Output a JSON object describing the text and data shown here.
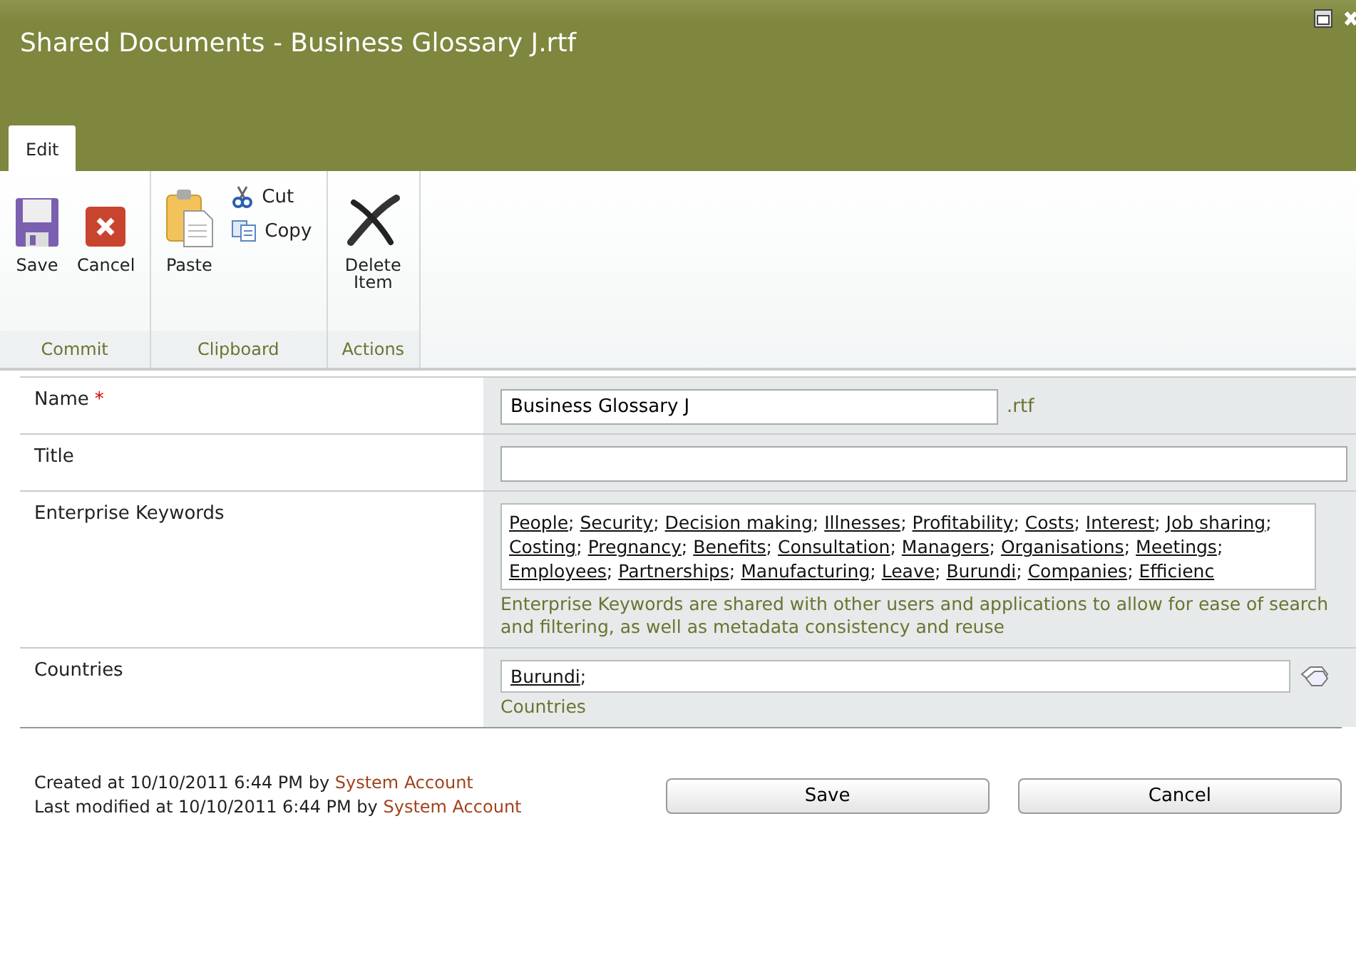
{
  "window": {
    "title": "Shared Documents - Business Glossary J.rtf"
  },
  "tabs": [
    {
      "label": "Edit",
      "selected": true
    }
  ],
  "ribbon": {
    "groups": [
      {
        "label": "Commit",
        "buttons": [
          {
            "kind": "save",
            "label": "Save"
          },
          {
            "kind": "cancel",
            "label": "Cancel"
          }
        ]
      },
      {
        "label": "Clipboard",
        "buttons": [
          {
            "kind": "paste",
            "label": "Paste"
          },
          {
            "kind": "cut",
            "label": "Cut"
          },
          {
            "kind": "copy",
            "label": "Copy"
          }
        ]
      },
      {
        "label": "Actions",
        "buttons": [
          {
            "kind": "delete",
            "label": "Delete Item"
          }
        ]
      }
    ]
  },
  "form": {
    "required_mark": "*",
    "term_separator": ";",
    "fields": [
      {
        "kind": "text",
        "label": "Name",
        "required": true,
        "value": "Business Glossary J",
        "suffix": ".rtf"
      },
      {
        "kind": "text",
        "label": "Title",
        "required": false
      },
      {
        "kind": "keywords",
        "label": "Enterprise Keywords",
        "required": false,
        "terms": [
          "People",
          "Security",
          "Decision making",
          "Illnesses",
          "Profitability",
          "Costs",
          "Interest",
          "Job sharing",
          "Costing",
          "Pregnancy",
          "Benefits",
          "Consultation",
          "Managers",
          "Organisations",
          "Meetings",
          "Employees",
          "Partnerships",
          "Manufacturing",
          "Leave",
          "Burundi",
          "Companies",
          "Efficienc"
        ],
        "hint": "Enterprise Keywords are shared with other users and applications to allow for ease of search and filtering, as well as metadata consistency and reuse"
      },
      {
        "kind": "taxonomy",
        "label": "Countries",
        "required": false,
        "terms": [
          "Burundi"
        ],
        "hint": "Countries"
      }
    ]
  },
  "footer": {
    "lines": [
      {
        "text": "Created at 10/10/2011 6:44 PM by",
        "user": "System Account"
      },
      {
        "text": "Last modified at 10/10/2011 6:44 PM by",
        "user": "System Account"
      }
    ],
    "buttons": [
      "Save",
      "Cancel"
    ]
  }
}
